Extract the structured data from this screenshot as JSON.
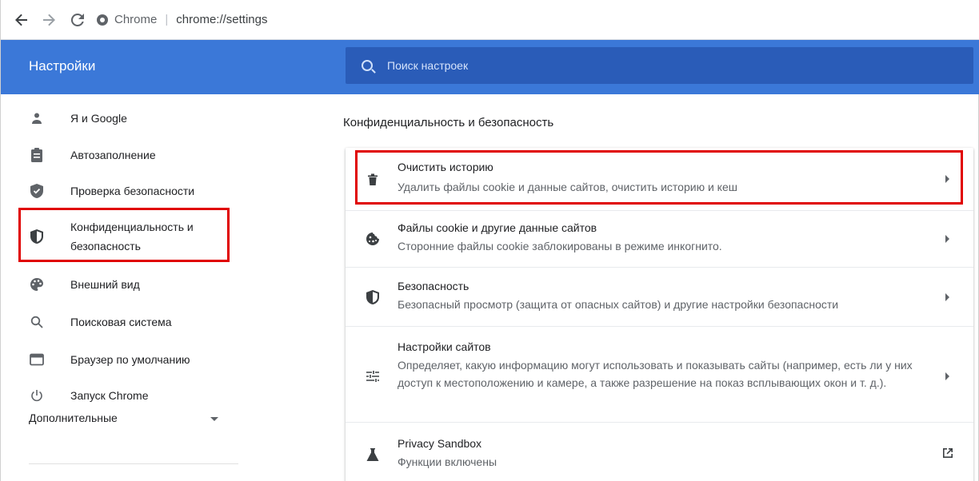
{
  "browser": {
    "site_name": "Chrome",
    "url": "chrome://settings"
  },
  "header": {
    "title": "Настройки",
    "search_placeholder": "Поиск настроек"
  },
  "sidebar": {
    "items": [
      {
        "label": "Я и Google",
        "icon": "person-icon"
      },
      {
        "label": "Автозаполнение",
        "icon": "clipboard-icon"
      },
      {
        "label": "Проверка безопасности",
        "icon": "shield-check-icon"
      },
      {
        "label": "Конфиденциальность и безопасность",
        "icon": "shield-half-icon"
      },
      {
        "label": "Внешний вид",
        "icon": "palette-icon"
      },
      {
        "label": "Поисковая система",
        "icon": "search-icon"
      },
      {
        "label": "Браузер по умолчанию",
        "icon": "browser-window-icon"
      },
      {
        "label": "Запуск Chrome",
        "icon": "power-icon"
      }
    ],
    "advanced_label": "Дополнительные"
  },
  "main": {
    "section_title": "Конфиденциальность и безопасность",
    "rows": [
      {
        "title": "Очистить историю",
        "subtitle": "Удалить файлы cookie и данные сайтов, очистить историю и кеш",
        "icon": "trash-icon"
      },
      {
        "title": "Файлы cookie и другие данные сайтов",
        "subtitle": "Сторонние файлы cookie заблокированы в режиме инкогнито.",
        "icon": "cookie-icon"
      },
      {
        "title": "Безопасность",
        "subtitle": "Безопасный просмотр (защита от опасных сайтов) и другие настройки безопасности",
        "icon": "shield-half-icon"
      },
      {
        "title": "Настройки сайтов",
        "subtitle": "Определяет, какую информацию могут использовать и показывать сайты (например, есть ли у них доступ к местоположению и камере, а также разрешение на показ всплывающих окон и т. д.).",
        "icon": "tune-icon"
      },
      {
        "title": "Privacy Sandbox",
        "subtitle": "Функции включены",
        "icon": "flask-icon"
      }
    ]
  },
  "colors": {
    "header_bg": "#3b78d8",
    "search_bg": "#2a5cb8",
    "highlight_red": "#e00000"
  }
}
